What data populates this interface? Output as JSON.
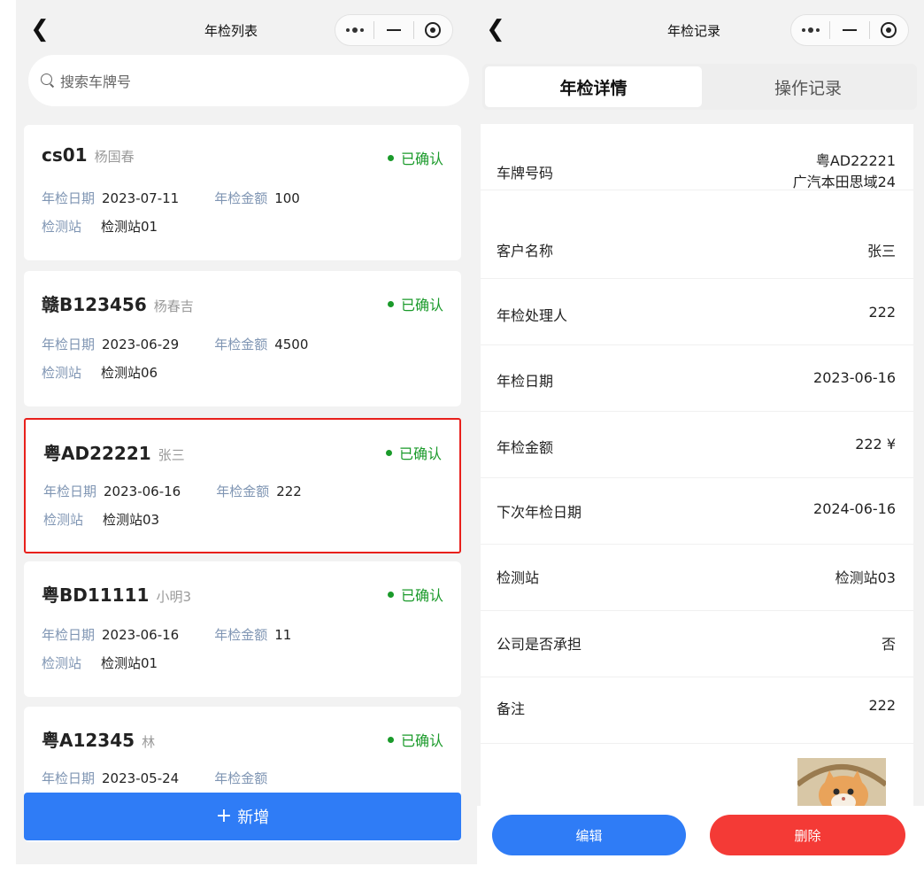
{
  "left": {
    "nav": {
      "back_icon": "chevron-left-icon",
      "title": "年检列表"
    },
    "search": {
      "placeholder": "搜索车牌号",
      "icon": "search-icon"
    },
    "cards": [
      {
        "plate": "cs01",
        "owner": "杨国春",
        "status": "已确认",
        "date_label": "年检日期",
        "date": "2023-07-11",
        "amount_label": "年检金额",
        "amount": "100",
        "station_label": "检测站",
        "station": "检测站01",
        "selected": false
      },
      {
        "plate": "赣B123456",
        "owner": "杨春吉",
        "status": "已确认",
        "date_label": "年检日期",
        "date": "2023-06-29",
        "amount_label": "年检金额",
        "amount": "4500",
        "station_label": "检测站",
        "station": "检测站06",
        "selected": false
      },
      {
        "plate": "粤AD22221",
        "owner": "张三",
        "status": "已确认",
        "date_label": "年检日期",
        "date": "2023-06-16",
        "amount_label": "年检金额",
        "amount": "222",
        "station_label": "检测站",
        "station": "检测站03",
        "selected": true
      },
      {
        "plate": "粤BD11111",
        "owner": "小明3",
        "status": "已确认",
        "date_label": "年检日期",
        "date": "2023-06-16",
        "amount_label": "年检金额",
        "amount": "11",
        "station_label": "检测站",
        "station": "检测站01",
        "selected": false
      },
      {
        "plate": "粤A12345",
        "owner": "林",
        "status": "已确认",
        "date_label": "年检日期",
        "date": "2023-05-24",
        "amount_label": "年检金额",
        "amount": "",
        "station_label": "",
        "station": "",
        "selected": false
      }
    ],
    "add_button": {
      "icon": "+",
      "label": "新增"
    }
  },
  "right": {
    "nav": {
      "back_icon": "chevron-left-icon",
      "title": "年检记录"
    },
    "tabs": [
      {
        "label": "年检详情",
        "active": true
      },
      {
        "label": "操作记录",
        "active": false
      }
    ],
    "details": [
      {
        "label": "车牌号码",
        "value": "粤AD22221",
        "value2": "广汽本田思域24"
      },
      {
        "label": "客户名称",
        "value": "张三"
      },
      {
        "label": "年检处理人",
        "value": "222"
      },
      {
        "label": "年检日期",
        "value": "2023-06-16"
      },
      {
        "label": "年检金额",
        "value": "222 ¥"
      },
      {
        "label": "下次年检日期",
        "value": "2024-06-16"
      },
      {
        "label": "检测站",
        "value": "检测站03"
      },
      {
        "label": "公司是否承担",
        "value": "否"
      },
      {
        "label": "备注",
        "value": "222"
      }
    ],
    "photo_icon": "cat-photo-thumbnail",
    "buttons": {
      "edit": "编辑",
      "delete": "删除"
    }
  },
  "colors": {
    "primary": "#2f7cf6",
    "danger": "#f43a36",
    "success": "#1a9a2a",
    "label": "#7f95b3",
    "selected_border": "#e8201c"
  }
}
